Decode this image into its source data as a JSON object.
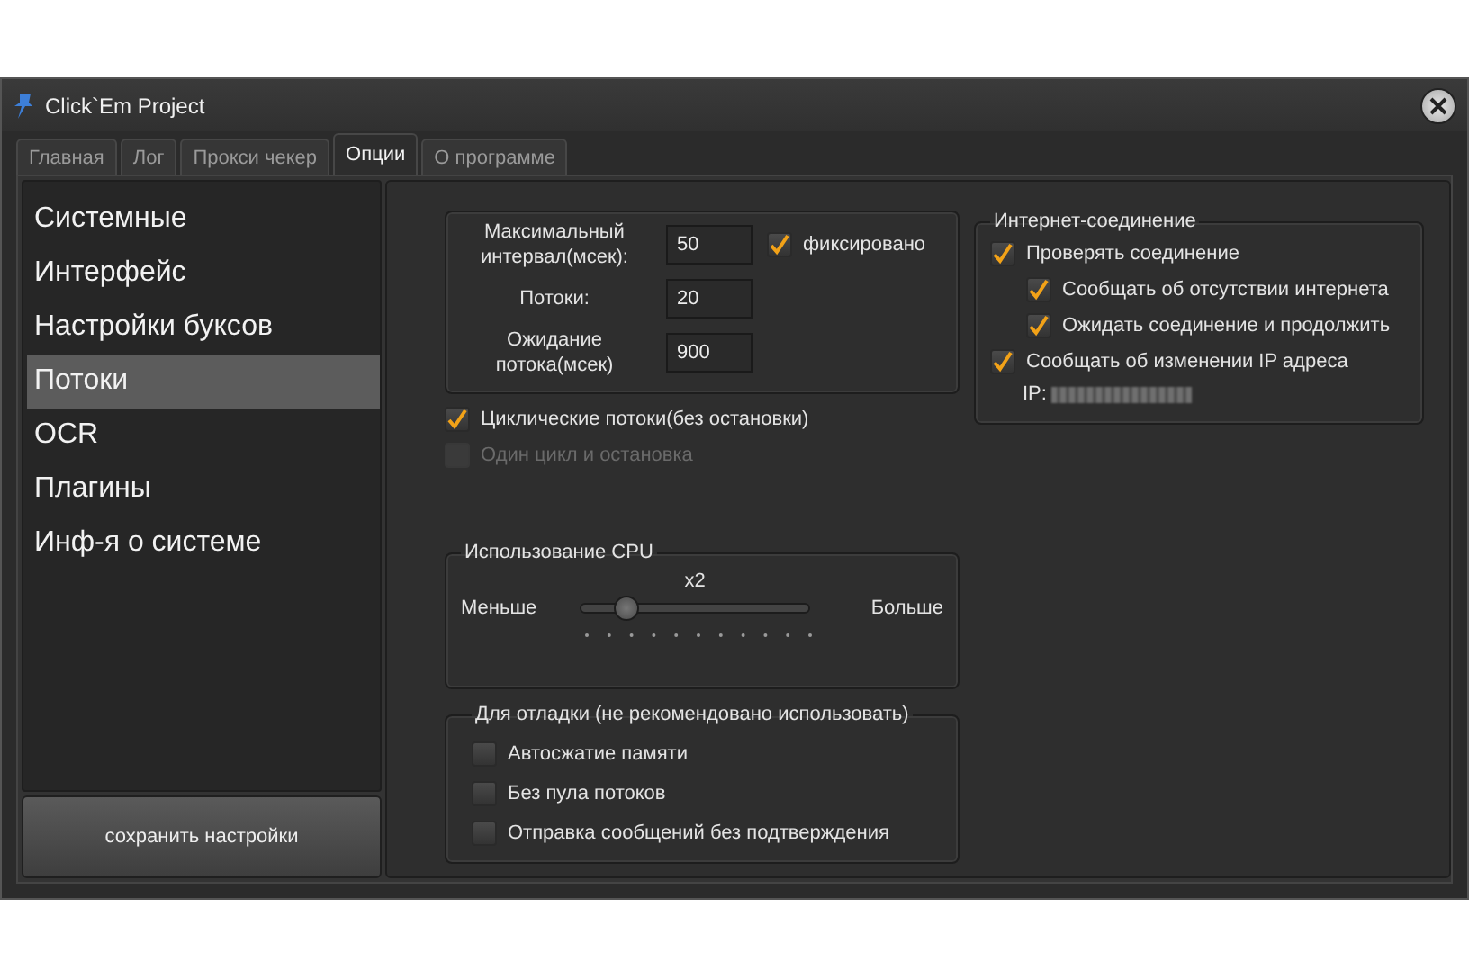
{
  "window": {
    "title": "Click`Em Project"
  },
  "tabs": [
    {
      "label": "Главная",
      "selected": false
    },
    {
      "label": "Лог",
      "selected": false
    },
    {
      "label": "Прокси чекер",
      "selected": false
    },
    {
      "label": "Опции",
      "selected": true
    },
    {
      "label": "О программе",
      "selected": false
    }
  ],
  "sidebar": {
    "items": [
      {
        "label": "Системные",
        "selected": false
      },
      {
        "label": "Интерфейс",
        "selected": false
      },
      {
        "label": "Настройки буксов",
        "selected": false
      },
      {
        "label": "Потоки",
        "selected": true
      },
      {
        "label": "OCR",
        "selected": false
      },
      {
        "label": "Плагины",
        "selected": false
      },
      {
        "label": "Инф-я о системе",
        "selected": false
      }
    ],
    "save_button": "сохранить настройки"
  },
  "thread_settings": {
    "fields": [
      {
        "label": "Максимальный интервал(мсек):",
        "value": "50"
      },
      {
        "label": "Потоки:",
        "value": "20"
      },
      {
        "label": "Ожидание потока(мсек)",
        "value": "900"
      }
    ],
    "fixed": {
      "label": "фиксировано",
      "checked": true
    }
  },
  "options": [
    {
      "label": "Циклические потоки(без остановки)",
      "checked": true,
      "disabled": false
    },
    {
      "label": "Один цикл и остановка",
      "checked": false,
      "disabled": true
    }
  ],
  "cpu": {
    "title": "Использование CPU",
    "value_label": "x2",
    "min_label": "Меньше",
    "max_label": "Больше",
    "level": 0.2
  },
  "debug": {
    "title": "Для отладки (не рекомендовано использовать)",
    "options": [
      {
        "label": "Автосжатие памяти",
        "checked": false
      },
      {
        "label": "Без пула потоков",
        "checked": false
      },
      {
        "label": "Отправка сообщений без подтверждения",
        "checked": false
      }
    ]
  },
  "internet": {
    "title": "Интернет-соединение",
    "options": [
      {
        "label": "Проверять соединение",
        "checked": true,
        "children": [
          {
            "label": "Сообщать об отсутствии интернета",
            "checked": true
          },
          {
            "label": "Ожидать соединение и продолжить",
            "checked": true
          }
        ]
      },
      {
        "label": "Сообщать об изменении IP адреса",
        "checked": true
      }
    ],
    "ip_label": "IP:"
  }
}
